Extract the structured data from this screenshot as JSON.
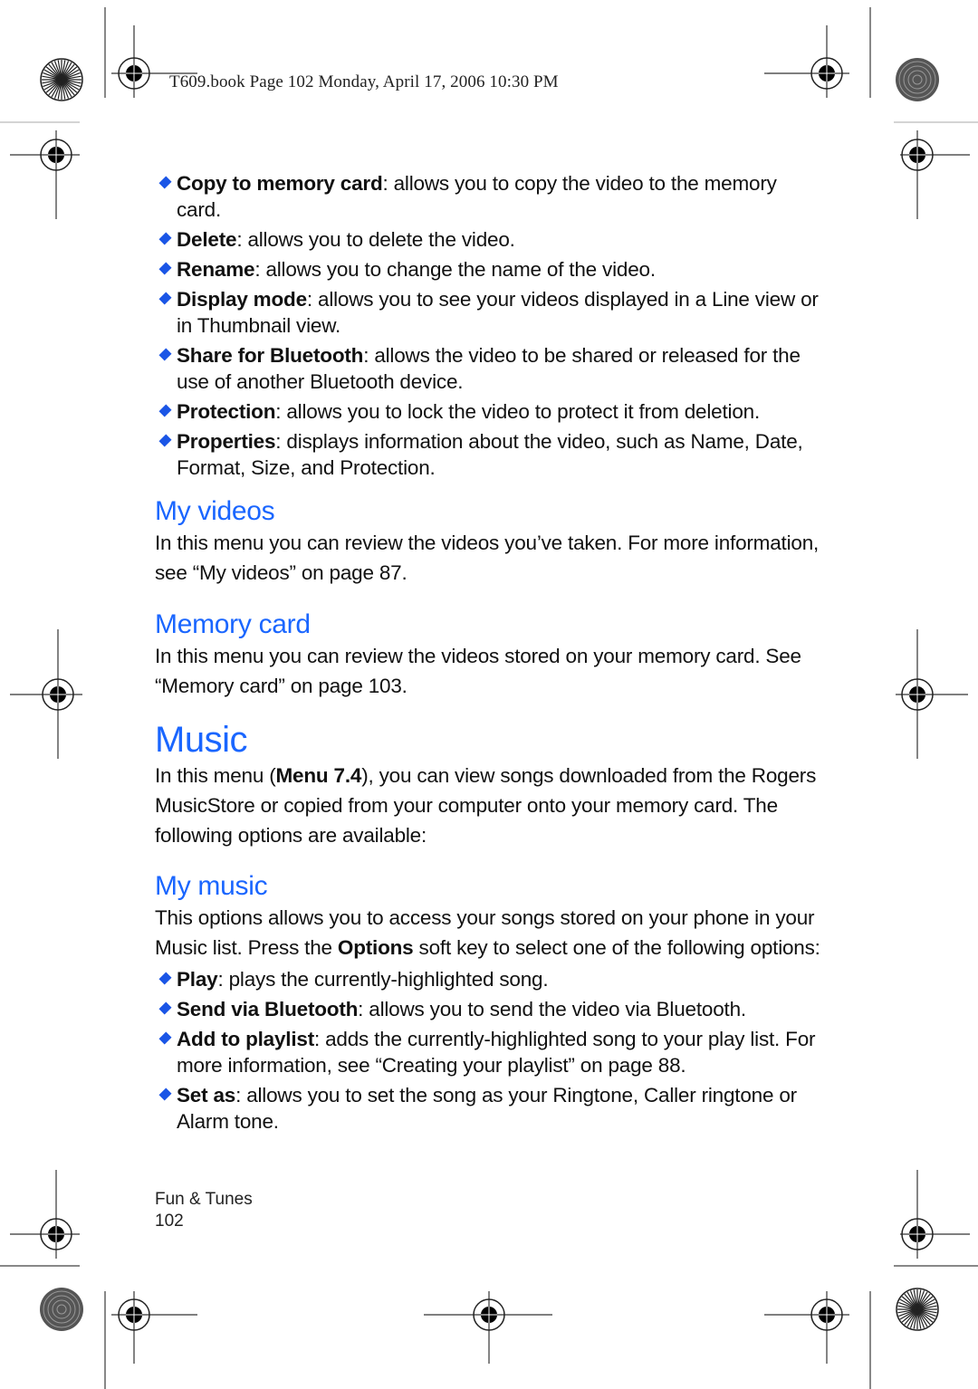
{
  "header": {
    "text": "T609.book  Page 102  Monday, April 17, 2006  10:30 PM"
  },
  "top_bullets": [
    {
      "term": "Copy to memory card",
      "text": ": allows you to copy the video to the memory card."
    },
    {
      "term": "Delete",
      "text": ": allows you to delete the video."
    },
    {
      "term": "Rename",
      "text": ": allows you to change the name of the video."
    },
    {
      "term": "Display mode",
      "text": ": allows you to see your videos displayed in a Line view or in Thumbnail view."
    },
    {
      "term": "Share for Bluetooth",
      "text": ": allows the video to be shared or released for the use of another Bluetooth device."
    },
    {
      "term": "Protection",
      "text": ": allows you to lock the video to protect it from deletion."
    },
    {
      "term": "Properties",
      "text": ": displays information about the video, such as Name, Date, Format, Size, and Protection."
    }
  ],
  "sections": {
    "my_videos": {
      "title": "My videos",
      "body": "In this menu you can review the videos you’ve taken. For more information, see “My videos” on page 87."
    },
    "memory_card": {
      "title": "Memory card",
      "body": "In this menu you can review the videos stored on your memory card. See “Memory card” on page 103."
    },
    "music": {
      "title": "Music",
      "body_pre": "In this menu (",
      "body_bold": "Menu 7.4",
      "body_post": "), you can view songs downloaded from the Rogers MusicStore or copied from your computer onto your memory card. The following options are available:"
    },
    "my_music": {
      "title": "My music",
      "body_pre": "This options allows you to access your songs stored on your phone in your Music list. Press the ",
      "body_bold": "Options",
      "body_post": " soft key to select one of the following options:"
    }
  },
  "music_bullets": [
    {
      "term": "Play",
      "text": ": plays the currently-highlighted song."
    },
    {
      "term": "Send via Bluetooth",
      "text": ": allows you to send the video via Bluetooth."
    },
    {
      "term": "Add to playlist",
      "text": ": adds the currently-highlighted song to your play list. For more information, see “Creating your playlist” on page 88."
    },
    {
      "term": "Set as",
      "text": ": allows you to set the song as your Ringtone, Caller ringtone or Alarm tone."
    }
  ],
  "footer": {
    "section": "Fun & Tunes",
    "page_number": "102"
  },
  "colors": {
    "heading": "#1a66ff",
    "bullet": "#1a55e6"
  }
}
